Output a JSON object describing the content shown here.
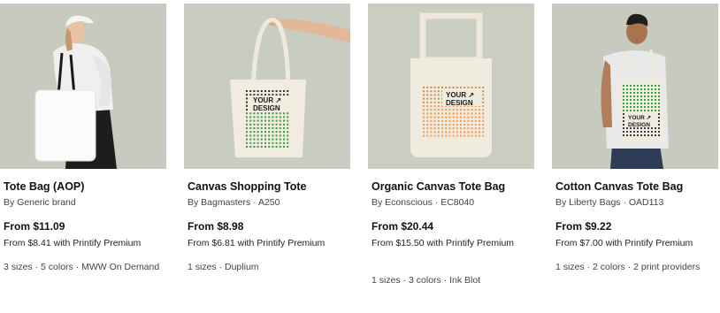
{
  "products": [
    {
      "title": "Tote Bag (AOP)",
      "brand": "By Generic brand",
      "price": "From $11.09",
      "premium_price": "From $8.41 with Printify Premium",
      "meta": "3 sizes · 5 colors · MWW On Demand"
    },
    {
      "title": "Canvas Shopping Tote",
      "brand": "By Bagmasters · A250",
      "price": "From $8.98",
      "premium_price": "From $6.81 with Printify Premium",
      "meta": "1 sizes · Duplium",
      "design_label_line1": "YOUR ↗",
      "design_label_line2": "DESIGN"
    },
    {
      "title": "Organic Canvas Tote Bag",
      "brand": "By Econscious · EC8040",
      "price": "From $20.44",
      "premium_price": "From $15.50 with Printify Premium",
      "meta": "1 sizes · 3 colors · Ink Blot",
      "design_label_line1": "YOUR ↗",
      "design_label_line2": "DESIGN"
    },
    {
      "title": "Cotton Canvas Tote Bag",
      "brand": "By Liberty Bags · OAD113",
      "price": "From $9.22",
      "premium_price": "From $7.00 with Printify Premium",
      "meta": "1 sizes · 2 colors · 2 print providers",
      "design_label_line1": "YOUR ↗",
      "design_label_line2": "DESIGN"
    }
  ]
}
